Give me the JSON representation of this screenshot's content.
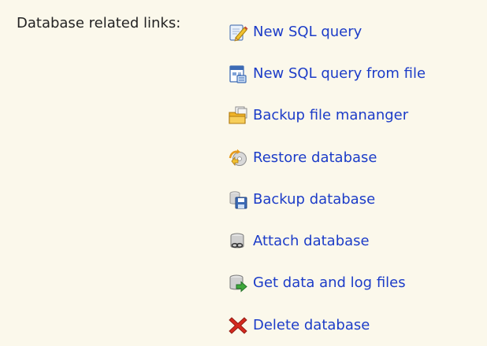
{
  "section": {
    "label": "Database related links:"
  },
  "links": [
    {
      "label": "New SQL query",
      "icon": "pencil-document-icon"
    },
    {
      "label": "New SQL query from file",
      "icon": "window-file-icon"
    },
    {
      "label": "Backup file mananger",
      "icon": "folder-documents-icon"
    },
    {
      "label": "Restore database",
      "icon": "restore-disk-icon"
    },
    {
      "label": "Backup database",
      "icon": "backup-disk-icon"
    },
    {
      "label": "Attach database",
      "icon": "attach-database-icon"
    },
    {
      "label": "Get data and log files",
      "icon": "database-arrow-icon"
    },
    {
      "label": "Delete database",
      "icon": "red-x-icon"
    }
  ],
  "colors": {
    "background": "#FBF8EB",
    "link": "#1C3CC8",
    "label": "#222222",
    "delete": "#D42A1F"
  }
}
